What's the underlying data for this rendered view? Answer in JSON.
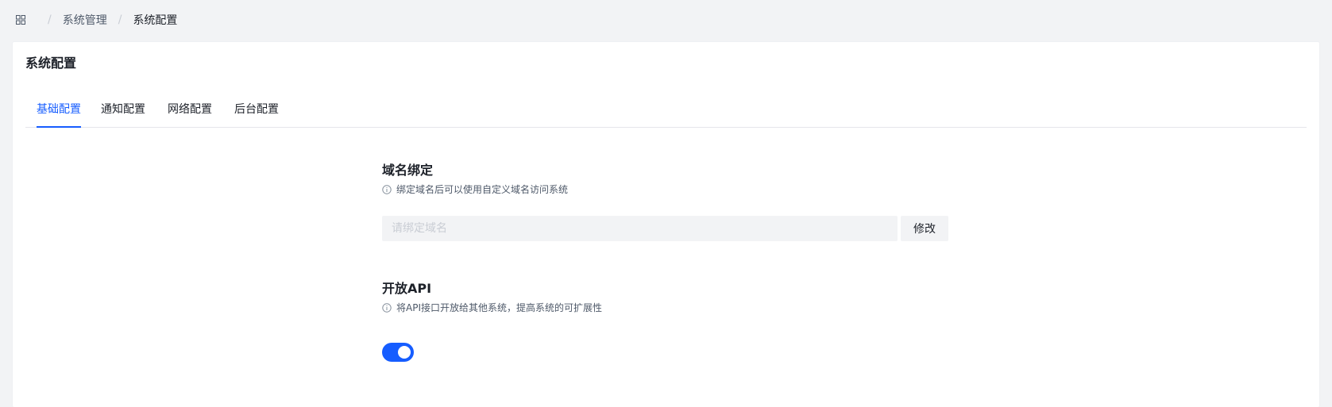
{
  "breadcrumb": {
    "icon": "apps-icon",
    "items": [
      "系统管理",
      "系统配置"
    ],
    "separator": "/"
  },
  "card": {
    "title": "系统配置"
  },
  "tabs": [
    {
      "label": "基础配置",
      "active": true
    },
    {
      "label": "通知配置",
      "active": false
    },
    {
      "label": "网络配置",
      "active": false
    },
    {
      "label": "后台配置",
      "active": false
    }
  ],
  "domain": {
    "title": "域名绑定",
    "desc": "绑定域名后可以使用自定义域名访问系统",
    "placeholder": "请绑定域名",
    "value": "",
    "button": "修改"
  },
  "api": {
    "title": "开放API",
    "desc": "将API接口开放给其他系统，提高系统的可扩展性",
    "enabled": true
  },
  "colors": {
    "primary": "#165dff",
    "background": "#f2f3f5",
    "text": "#1d2129",
    "secondary_text": "#4e5969"
  }
}
